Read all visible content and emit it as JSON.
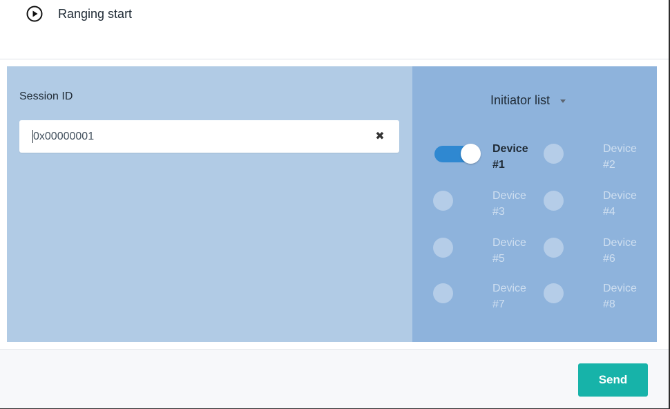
{
  "dialog": {
    "title": "Ranging start",
    "header_icon": "play-circle-icon"
  },
  "session": {
    "label": "Session ID",
    "value": "0x00000001",
    "clear_icon": "close-icon"
  },
  "initiator": {
    "label": "Initiator list",
    "dropdown_icon": "caret-down-icon"
  },
  "devices": [
    {
      "label_line1": "Device",
      "label_line2": "#1",
      "selected": true
    },
    {
      "label_line1": "Device",
      "label_line2": "#2",
      "selected": false
    },
    {
      "label_line1": "Device",
      "label_line2": "#3",
      "selected": false
    },
    {
      "label_line1": "Device",
      "label_line2": "#4",
      "selected": false
    },
    {
      "label_line1": "Device",
      "label_line2": "#5",
      "selected": false
    },
    {
      "label_line1": "Device",
      "label_line2": "#6",
      "selected": false
    },
    {
      "label_line1": "Device",
      "label_line2": "#7",
      "selected": false
    },
    {
      "label_line1": "Device",
      "label_line2": "#8",
      "selected": false
    }
  ],
  "footer": {
    "send_label": "Send"
  },
  "colors": {
    "accent": "#17b3a9",
    "toggle_on": "#2f88d1",
    "left_panel": "#b1cbe5",
    "right_panel": "#8eb3dc"
  }
}
